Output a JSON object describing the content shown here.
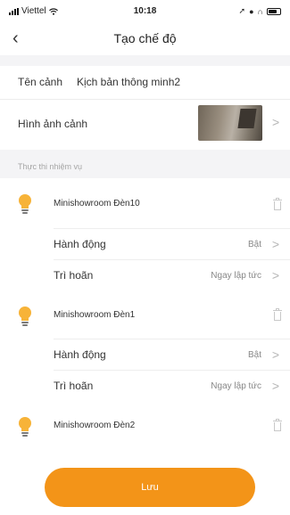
{
  "status_bar": {
    "carrier": "Viettel",
    "time": "10:18"
  },
  "header": {
    "title": "Tạo chế độ"
  },
  "scene": {
    "name_label": "Tên cảnh",
    "name_value": "Kịch bản thông minh2",
    "image_label": "Hình ảnh cảnh"
  },
  "tasks_section": {
    "title": "Thực thi nhiệm vụ"
  },
  "tasks": [
    {
      "device": "Minishowroom Đèn10",
      "action_label": "Hành động",
      "action_value": "Bật",
      "delay_label": "Trì hoãn",
      "delay_value": "Ngay lập tức"
    },
    {
      "device": "Minishowroom Đèn1",
      "action_label": "Hành động",
      "action_value": "Bật",
      "delay_label": "Trì hoãn",
      "delay_value": "Ngay lập tức"
    },
    {
      "device": "Minishowroom Đèn2"
    }
  ],
  "save_label": "Lưu",
  "colors": {
    "accent": "#f39418",
    "bulb": "#f7b338",
    "background": "#f4f4f6"
  },
  "icons": {
    "back": "chevron-left-icon",
    "row_chevron": "chevron-right-icon",
    "device": "light-bulb-icon",
    "delete": "trash-icon"
  }
}
